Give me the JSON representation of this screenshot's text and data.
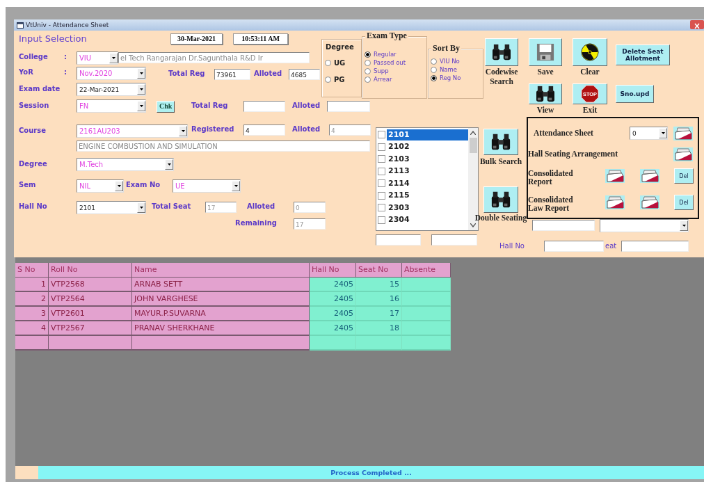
{
  "window": {
    "title": "VtUniv - Attendance Sheet"
  },
  "header": {
    "title": "Input Selection",
    "date": "30-Mar-2021",
    "time": "10:53:11 AM"
  },
  "college": {
    "label": "College",
    "separator": ":",
    "code": "VIU",
    "name": "el Tech Rangarajan Dr.Sagunthala R&D Ir"
  },
  "yor": {
    "label": "YoR",
    "separator": ":",
    "value": "Nov.2020",
    "total_reg_label": "Total Reg",
    "total_reg": "73961",
    "alloted_label": "Alloted",
    "alloted": "4685"
  },
  "exam_date": {
    "label": "Exam date",
    "value": "22-Mar-2021"
  },
  "session": {
    "label": "Session",
    "value": "FN",
    "check_button": "Chk",
    "total_reg_label": "Total Reg",
    "alloted_label": "Alloted"
  },
  "course": {
    "label": "Course",
    "value": "2161AU203",
    "registered_label": "Registered",
    "registered": "4",
    "alloted_label": "Alloted",
    "alloted": "4",
    "title": "ENGINE COMBUSTION AND SIMULATION"
  },
  "degree_select": {
    "label": "Degree",
    "value": "M.Tech"
  },
  "sem": {
    "label": "Sem",
    "value": "NIL",
    "exam_no_label": "Exam No",
    "exam_no": "UE"
  },
  "hall": {
    "label": "Hall No",
    "value": "2101",
    "total_seat_label": "Total Seat",
    "total_seat": "17",
    "alloted_label": "Alloted",
    "alloted": "0",
    "remaining_label": "Remaining",
    "remaining": "17"
  },
  "degree": {
    "title": "Degree",
    "options": [
      {
        "label": "UG",
        "selected": false
      },
      {
        "label": "PG",
        "selected": false
      }
    ]
  },
  "exam_type": {
    "title": "Exam Type",
    "options": [
      {
        "label": "Regular",
        "selected": true
      },
      {
        "label": "Passed out",
        "selected": false
      },
      {
        "label": "Supp",
        "selected": false
      },
      {
        "label": "Arrear",
        "selected": false
      }
    ]
  },
  "sort_by": {
    "title": "Sort By",
    "options": [
      {
        "label": "VIU No",
        "selected": false
      },
      {
        "label": "Name",
        "selected": false
      },
      {
        "label": "Reg No",
        "selected": true
      }
    ]
  },
  "actions": [
    {
      "kind": "binoculars",
      "label": "Codewise Search"
    },
    {
      "kind": "floppy",
      "label": "Save"
    },
    {
      "kind": "radiation",
      "label": "Clear"
    },
    {
      "kind": "text",
      "label": "Delete Seat Allotment"
    },
    {
      "kind": "binoculars",
      "label": "View"
    },
    {
      "kind": "stop",
      "label": "Exit",
      "icon_text": "STOP"
    },
    {
      "kind": "text",
      "label": "Sno.upd"
    }
  ],
  "halls": {
    "items": [
      {
        "label": "2101",
        "selected": true,
        "checked": false
      },
      {
        "label": "2102",
        "selected": false,
        "checked": false
      },
      {
        "label": "2103",
        "selected": false,
        "checked": false
      },
      {
        "label": "2113",
        "selected": false,
        "checked": false
      },
      {
        "label": "2114",
        "selected": false,
        "checked": false
      },
      {
        "label": "2115",
        "selected": false,
        "checked": false
      },
      {
        "label": "2303",
        "selected": false,
        "checked": false
      },
      {
        "label": "2304",
        "selected": false,
        "checked": false
      }
    ]
  },
  "bulk_actions": [
    {
      "kind": "binoculars",
      "label": "Bulk Search"
    },
    {
      "kind": "binoculars",
      "label": "Double Seating"
    }
  ],
  "reports": [
    {
      "kind": "combo",
      "label": "Attendance Sheet",
      "value": "0"
    },
    {
      "kind": "single",
      "label": "Hall Seating Arrangement"
    },
    {
      "kind": "double",
      "label": "Consolidated Report",
      "delete_label": "Del"
    },
    {
      "kind": "double",
      "label": "Consolidated Law Report",
      "delete_label": "Del"
    }
  ],
  "lookup": {
    "hall_label": "Hall No",
    "seat_label": "eat"
  },
  "grid": {
    "columns": [
      "S No",
      "Roll No",
      "Name",
      "Hall No",
      "Seat No",
      "Absente"
    ],
    "rows": [
      {
        "s_no": "1",
        "roll_no": "VTP2568",
        "name": "ARNAB SETT",
        "hall_no": "2405",
        "seat_no": "15"
      },
      {
        "s_no": "2",
        "roll_no": "VTP2564",
        "name": "JOHN VARGHESE",
        "hall_no": "2405",
        "seat_no": "16"
      },
      {
        "s_no": "3",
        "roll_no": "VTP2601",
        "name": "MAYUR.P.SUVARNA",
        "hall_no": "2405",
        "seat_no": "17"
      },
      {
        "s_no": "4",
        "roll_no": "VTP2567",
        "name": "PRANAV SHERKHANE",
        "hall_no": "2405",
        "seat_no": "18"
      }
    ]
  },
  "status_bar": {
    "text": "Process Completed ..."
  }
}
